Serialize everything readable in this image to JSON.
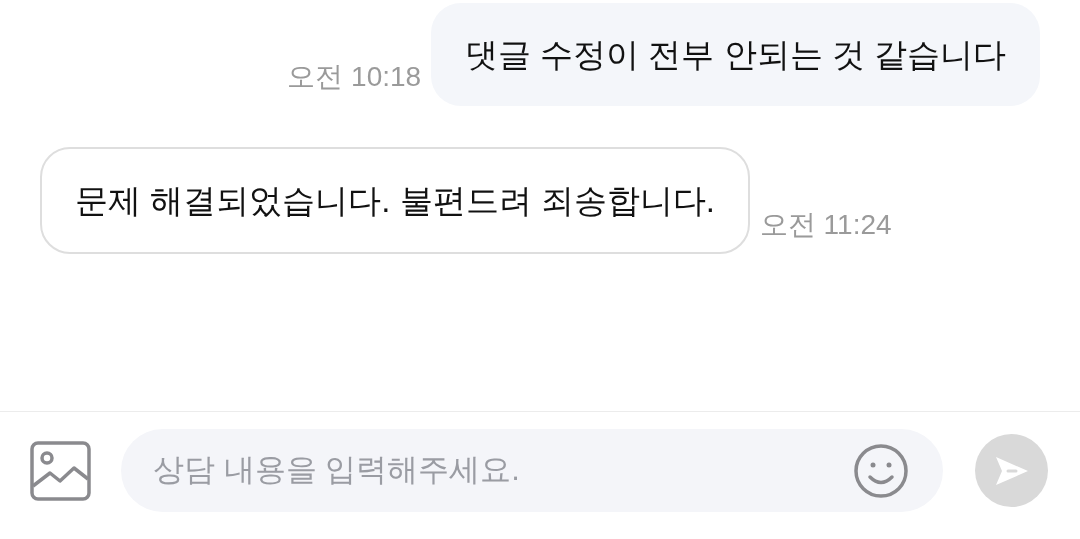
{
  "messages": [
    {
      "kind": "sent",
      "text": "댓글 수정이 전부 안되는 것 같습니다",
      "time": "오전 10:18"
    },
    {
      "kind": "received",
      "text": "문제 해결되었습니다. 불편드려 죄송합니다.",
      "time": "오전 11:24"
    }
  ],
  "composer": {
    "placeholder": "상담 내용을 입력해주세요.",
    "send_enabled": false
  }
}
